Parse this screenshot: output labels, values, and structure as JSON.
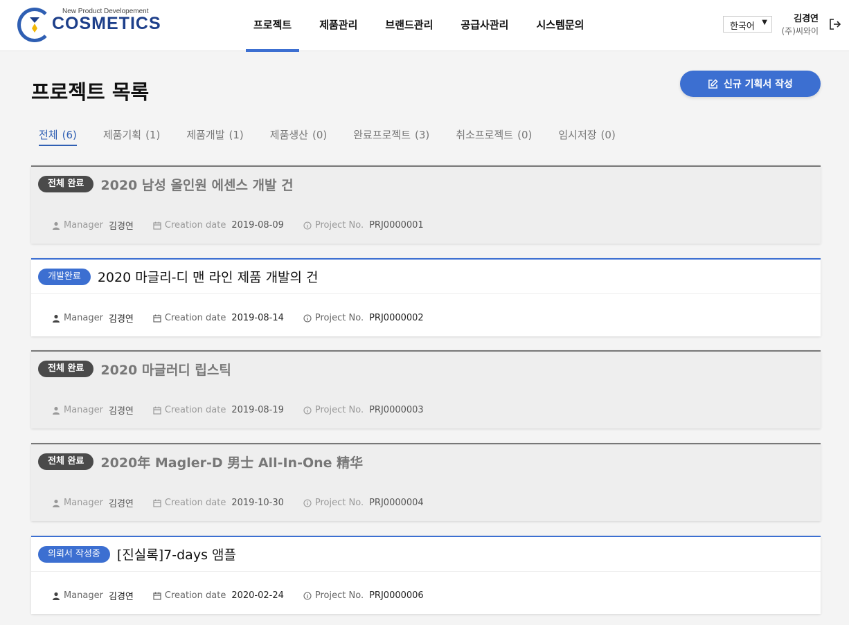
{
  "brand": {
    "tagline": "New Product Developement",
    "name": "COSMETICS",
    "colors": {
      "primary": "#3c6fd1",
      "navy": "#1d3f8a",
      "accent": "#f2b705"
    }
  },
  "nav": {
    "items": [
      {
        "label": "프로젝트",
        "active": true
      },
      {
        "label": "제품관리"
      },
      {
        "label": "브랜드관리"
      },
      {
        "label": "공급사관리"
      },
      {
        "label": "시스템문의"
      }
    ]
  },
  "header": {
    "language": "한국어",
    "user_name": "김경연",
    "company": "(주)씨와이",
    "logout_icon": "logout-icon"
  },
  "page": {
    "title": "프로젝트 목록",
    "new_button": "신규 기획서 작성"
  },
  "tabs": [
    {
      "label": "전체",
      "count": "(6)",
      "active": true
    },
    {
      "label": "제품기획",
      "count": "(1)"
    },
    {
      "label": "제품개발",
      "count": "(1)"
    },
    {
      "label": "제품생산",
      "count": "(0)"
    },
    {
      "label": "완료프로젝트",
      "count": "(3)"
    },
    {
      "label": "취소프로젝트",
      "count": "(0)"
    },
    {
      "label": "임시저장",
      "count": "(0)"
    }
  ],
  "meta_labels": {
    "manager": "Manager",
    "creation_date": "Creation date",
    "project_no": "Project No."
  },
  "projects": [
    {
      "status": "전체 완료",
      "title": "2020 남성 올인원 에센스 개발 건",
      "manager": "김경연",
      "date": "2019-08-09",
      "no": "PRJ0000001"
    },
    {
      "status": "개발완료",
      "title": "2020 마글리-디 맨 라인 제품 개발의 건",
      "manager": "김경연",
      "date": "2019-08-14",
      "no": "PRJ0000002"
    },
    {
      "status": "전체 완료",
      "title": "2020 마글러디 립스틱",
      "manager": "김경연",
      "date": "2019-08-19",
      "no": "PRJ0000003"
    },
    {
      "status": "전체 완료",
      "title": "2020年 Magler-D 男士 All-In-One 精华",
      "manager": "김경연",
      "date": "2019-10-30",
      "no": "PRJ0000004"
    },
    {
      "status": "의뢰서 작성중",
      "title": "[진실록]7-days 앰플",
      "manager": "김경연",
      "date": "2020-02-24",
      "no": "PRJ0000006"
    }
  ]
}
